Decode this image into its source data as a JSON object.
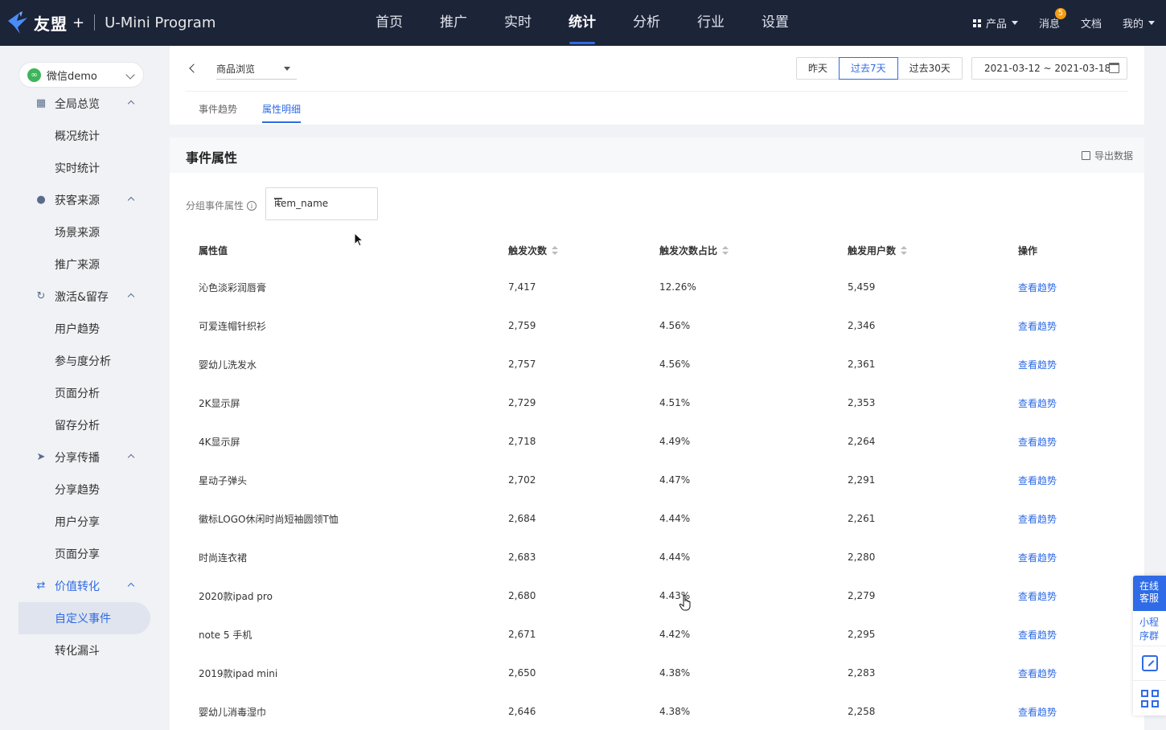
{
  "topnav": {
    "brand": "友盟",
    "brand_plus": "+",
    "product_name": "U-Mini Program",
    "menu": [
      "首页",
      "推广",
      "实时",
      "统计",
      "分析",
      "行业",
      "设置"
    ],
    "active_menu": "统计",
    "right": {
      "product": "产品",
      "messages": "消息",
      "message_count": "5",
      "docs": "文档",
      "mine": "我的"
    }
  },
  "sidebar": {
    "app_selector": "微信demo",
    "groups": [
      {
        "label": "全局总览",
        "icon": "grid-icon",
        "items": [
          "概况统计",
          "实时统计"
        ]
      },
      {
        "label": "获客来源",
        "icon": "users-icon",
        "items": [
          "场景来源",
          "推广来源"
        ]
      },
      {
        "label": "激活&留存",
        "icon": "refresh-icon",
        "items": [
          "用户趋势",
          "参与度分析",
          "页面分析",
          "留存分析"
        ]
      },
      {
        "label": "分享传播",
        "icon": "send-icon",
        "items": [
          "分享趋势",
          "用户分享",
          "页面分享"
        ]
      },
      {
        "label": "价值转化",
        "icon": "exchange-icon",
        "items": [
          "自定义事件",
          "转化漏斗"
        ]
      }
    ],
    "active_group": "价值转化",
    "active_item": "自定义事件"
  },
  "header": {
    "event_select": "商品浏览",
    "range_buttons": [
      "昨天",
      "过去7天",
      "过去30天"
    ],
    "active_range": "过去7天",
    "date_range": "2021-03-12 ~ 2021-03-18",
    "tabs": [
      "事件趋势",
      "属性明细"
    ],
    "active_tab": "属性明细"
  },
  "main": {
    "title": "事件属性",
    "export_label": "导出数据",
    "group_label": "分组事件属性",
    "group_value": "item_name",
    "columns": [
      "属性值",
      "触发次数",
      "触发次数占比",
      "触发用户数",
      "操作"
    ],
    "rows": [
      {
        "name": "沁色淡彩润唇膏",
        "count": "7,417",
        "ratio": "12.26%",
        "users": "5,459",
        "action": "查看趋势"
      },
      {
        "name": "可爱连帽针织衫",
        "count": "2,759",
        "ratio": "4.56%",
        "users": "2,346",
        "action": "查看趋势"
      },
      {
        "name": "婴幼儿洗发水",
        "count": "2,757",
        "ratio": "4.56%",
        "users": "2,361",
        "action": "查看趋势"
      },
      {
        "name": "2K显示屏",
        "count": "2,729",
        "ratio": "4.51%",
        "users": "2,353",
        "action": "查看趋势"
      },
      {
        "name": "4K显示屏",
        "count": "2,718",
        "ratio": "4.49%",
        "users": "2,264",
        "action": "查看趋势"
      },
      {
        "name": "星动子弹头",
        "count": "2,702",
        "ratio": "4.47%",
        "users": "2,291",
        "action": "查看趋势"
      },
      {
        "name": "徽标LOGO休闲时尚短袖圆领T恤",
        "count": "2,684",
        "ratio": "4.44%",
        "users": "2,261",
        "action": "查看趋势"
      },
      {
        "name": "时尚连衣裙",
        "count": "2,683",
        "ratio": "4.44%",
        "users": "2,280",
        "action": "查看趋势"
      },
      {
        "name": "2020款ipad pro",
        "count": "2,680",
        "ratio": "4.43%",
        "users": "2,279",
        "action": "查看趋势"
      },
      {
        "name": "note 5 手机",
        "count": "2,671",
        "ratio": "4.42%",
        "users": "2,295",
        "action": "查看趋势"
      },
      {
        "name": "2019款ipad mini",
        "count": "2,650",
        "ratio": "4.38%",
        "users": "2,283",
        "action": "查看趋势"
      },
      {
        "name": "婴幼儿消毒湿巾",
        "count": "2,646",
        "ratio": "4.38%",
        "users": "2,258",
        "action": "查看趋势"
      }
    ]
  },
  "float_tools": {
    "service": "在线客服",
    "service_line1": "在线",
    "service_line2": "客服",
    "group_line1": "小程",
    "group_line2": "序群"
  },
  "colors": {
    "nav_bg": "#1c2438",
    "accent": "#2f6be6",
    "page_bg": "#f0f2f5"
  }
}
